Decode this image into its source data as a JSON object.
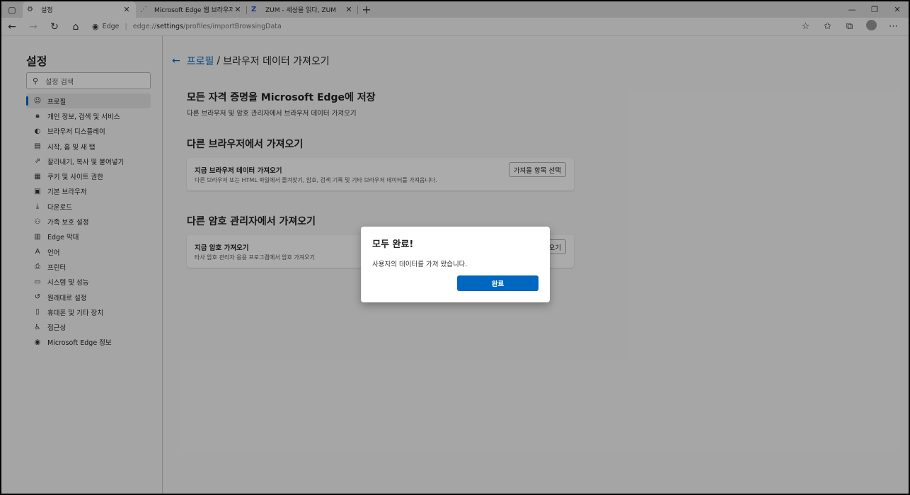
{
  "tabs": [
    {
      "title": "설정",
      "icon": "gear-icon",
      "active": true
    },
    {
      "title": "Microsoft Edge 웹 브라우저 다운",
      "icon": "loading-icon",
      "active": false
    },
    {
      "title": "ZUM - 세상을 읽다, ZUM",
      "icon": "zum-logo-icon",
      "active": false
    }
  ],
  "addressbar": {
    "site_label": "Edge",
    "url_prefix": "edge://",
    "url_strong": "settings",
    "url_suffix": "/profiles/importBrowsingData"
  },
  "sidebar": {
    "title": "설정",
    "search_placeholder": "설정 검색",
    "items": [
      {
        "label": "프로필",
        "icon": "profile-icon",
        "selected": true
      },
      {
        "label": "개인 정보, 검색 및 서비스",
        "icon": "lock-icon"
      },
      {
        "label": "브라우저 디스플레이",
        "icon": "palette-icon"
      },
      {
        "label": "시작, 홈 및 새 탭",
        "icon": "home-tab-icon"
      },
      {
        "label": "잘라내기, 복사 및 붙여넣기",
        "icon": "share-icon"
      },
      {
        "label": "쿠키 및 사이트 권한",
        "icon": "cookie-icon"
      },
      {
        "label": "기본 브라우저",
        "icon": "browser-icon"
      },
      {
        "label": "다운로드",
        "icon": "download-icon"
      },
      {
        "label": "가족 보호 설정",
        "icon": "family-icon"
      },
      {
        "label": "Edge 막대",
        "icon": "edge-bar-icon"
      },
      {
        "label": "언어",
        "icon": "language-icon"
      },
      {
        "label": "프린터",
        "icon": "printer-icon"
      },
      {
        "label": "시스템 및 성능",
        "icon": "laptop-icon"
      },
      {
        "label": "원래대로 설정",
        "icon": "reset-icon"
      },
      {
        "label": "휴대폰 및 기타 장치",
        "icon": "phone-icon"
      },
      {
        "label": "접근성",
        "icon": "accessibility-icon"
      },
      {
        "label": "Microsoft Edge 정보",
        "icon": "edge-logo-icon"
      }
    ]
  },
  "main": {
    "breadcrumb_link": "프로필",
    "breadcrumb_separator": "/",
    "breadcrumb_current": "브라우저 데이터 가져오기",
    "section1_title": "모든 자격 증명을 Microsoft Edge에 저장",
    "section1_sub": "다른 브라우저 및 암호 관리자에서 브라우저 데이터 가져오기",
    "section2_title": "다른 브라우저에서 가져오기",
    "card1": {
      "title": "지금 브라우저 데이터 가져오기",
      "desc": "다른 브라우저 또는 HTML 파일에서 즐겨찾기, 암호, 검색 기록 및 기타 브라우저 데이터를 가져옵니다.",
      "button": "가져올 항목 선택"
    },
    "section3_title": "다른 암호 관리자에서 가져오기",
    "card2": {
      "title": "지금 암호 가져오기",
      "desc": "타사 암호 관리자 응용 프로그램에서 암호 가져오기",
      "button": "가져오기"
    }
  },
  "dialog": {
    "title": "모두 완료!",
    "message": "사용자의 데이터를 가져 왔습니다.",
    "ok_label": "완료"
  },
  "colors": {
    "accent": "#0067c0",
    "overlay": "rgba(0,0,0,0.33)"
  }
}
